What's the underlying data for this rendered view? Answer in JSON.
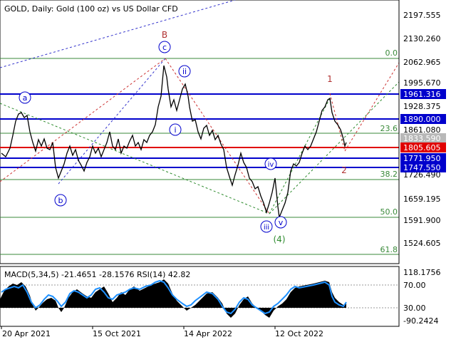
{
  "header": {
    "title": "GOLD, Daily:  Gold (100 oz) vs US Dollar CFD"
  },
  "indicator_label": "MACD(5,34,5) -21.4651 -28.1576 RSI(14) 42.82",
  "x_axis_labels": [
    "20 Apr 2021",
    "15 Oct 2021",
    "14 Apr 2022",
    "12 Oct 2022"
  ],
  "price_axis_labels": [
    "2197.555",
    "2130.260",
    "2062.965",
    "1995.670",
    "1928.375",
    "1861.080",
    "1726.490",
    "1659.195",
    "1591.900",
    "1524.605"
  ],
  "osc_axis_labels": [
    "118.1756",
    "70.00",
    "30.00",
    "-90.2424"
  ],
  "horizontal_levels": [
    {
      "price": "1961.316",
      "color": "#0000cc"
    },
    {
      "price": "1890.000",
      "color": "#0000cc"
    },
    {
      "price": "1833.590",
      "color": "#a0a0a0"
    },
    {
      "price": "1805.605",
      "color": "#e00000"
    },
    {
      "price": "1771.950",
      "color": "#0000cc"
    },
    {
      "price": "1747.550",
      "color": "#0000cc"
    }
  ],
  "fibo_labels": [
    "0.0",
    "23.6",
    "38.2",
    "50.0",
    "61.8"
  ],
  "wave_labels": {
    "a": "a",
    "b": "b",
    "c": "c",
    "B": "B",
    "i": "i",
    "ii": "ii",
    "iii": "iii",
    "iv": "iv",
    "v": "v",
    "four": "(4)",
    "one": "1",
    "two": "2"
  },
  "colors": {
    "bull": "#000000",
    "macd": "#000000",
    "rsi": "#1e90ff",
    "blue_line": "#0000cc",
    "red_line": "#e00000",
    "fibo": "#3a8a3a"
  }
}
